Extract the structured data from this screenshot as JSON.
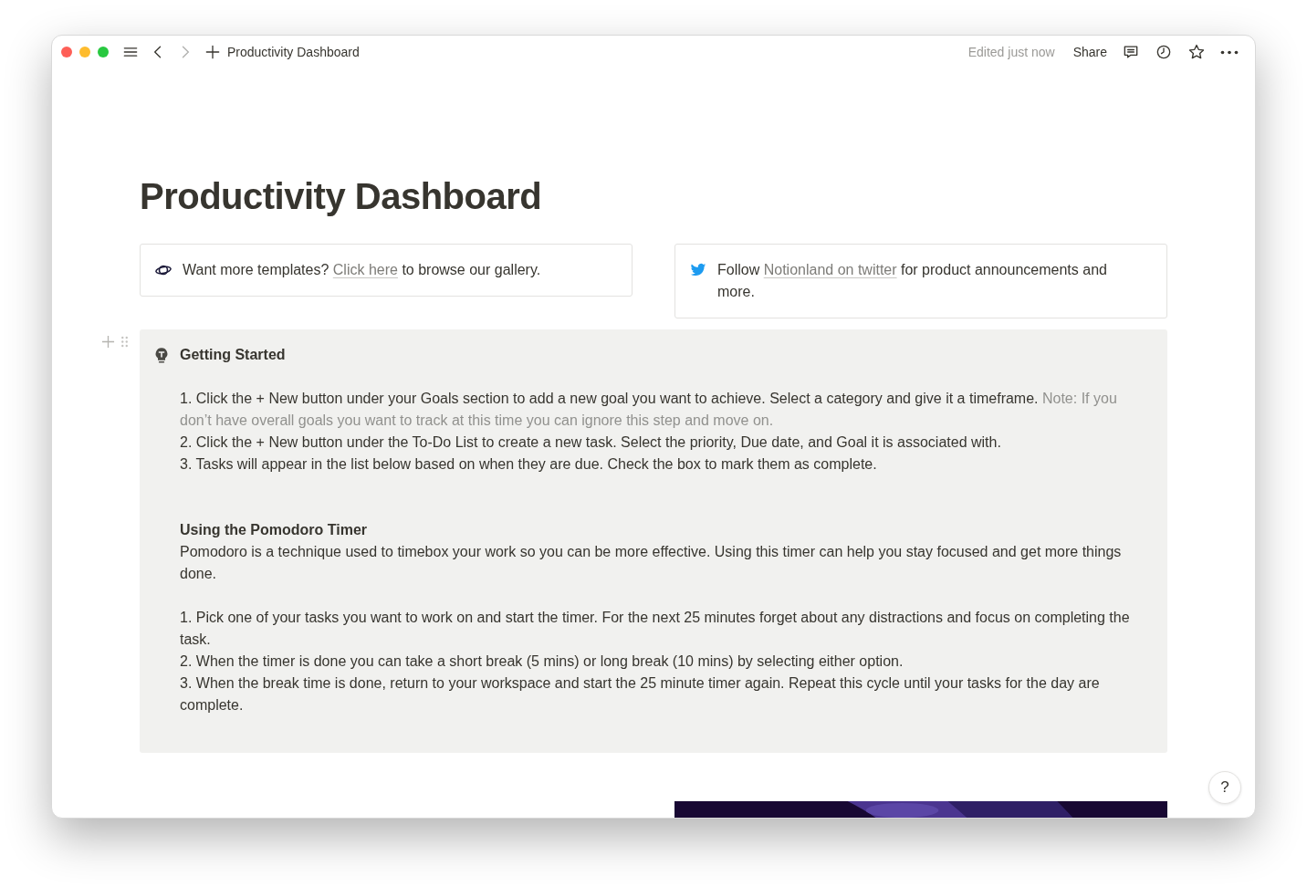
{
  "window": {
    "title": "Productivity Dashboard",
    "edited": "Edited just now",
    "share": "Share"
  },
  "page": {
    "title": "Productivity Dashboard"
  },
  "callouts": [
    {
      "kind": "gallery",
      "segments": [
        {
          "text": "Want more templates? ",
          "kind": "plain"
        },
        {
          "text": "Click here",
          "kind": "link"
        },
        {
          "text": " to browse our gallery.",
          "kind": "plain"
        }
      ]
    },
    {
      "kind": "bird",
      "segments": [
        {
          "text": "Follow ",
          "kind": "plain"
        },
        {
          "text": "Notionland on twitter",
          "kind": "link"
        },
        {
          "text": " for product announcements and more.",
          "kind": "plain"
        }
      ]
    }
  ],
  "guide": {
    "title": "Getting Started",
    "blocks": [
      {
        "kind": "paragraph",
        "segments": [
          {
            "text": "1. Click the + New button under your Goals section to add a new goal you want to achieve. Select a category and give it a timeframe. ",
            "muted": false
          },
          {
            "text": "Note: If you don’t have overall goals you want to track at this time you can ignore this step and move on.",
            "muted": true
          }
        ]
      },
      {
        "kind": "paragraph",
        "segments": [
          {
            "text": "2. Click the + New button under the To-Do List to create a new task. Select the priority, Due date, and Goal it is associated with.",
            "muted": false
          }
        ]
      },
      {
        "kind": "paragraph",
        "segments": [
          {
            "text": "3. Tasks will appear in the list below based on when they are due. Check the box to mark them as complete.",
            "muted": false
          }
        ]
      },
      {
        "kind": "spacer"
      },
      {
        "kind": "spacer"
      },
      {
        "kind": "subheading",
        "segments": [
          {
            "text": "Using the Pomodoro Timer",
            "muted": false
          }
        ]
      },
      {
        "kind": "paragraph",
        "segments": [
          {
            "text": "Pomodoro is a technique used to timebox your work so you can be more effective. Using this timer can help you stay focused and get more things done.",
            "muted": false
          }
        ]
      },
      {
        "kind": "spacer"
      },
      {
        "kind": "paragraph",
        "segments": [
          {
            "text": "1. Pick one of your tasks you want to work on and start the timer. For the next 25 minutes forget about any distractions and focus on completing the task.",
            "muted": false
          }
        ]
      },
      {
        "kind": "paragraph",
        "segments": [
          {
            "text": "2. When the timer is done you can take a short break (5 mins) or long break (10 mins) by selecting either option.",
            "muted": false
          }
        ]
      },
      {
        "kind": "paragraph",
        "segments": [
          {
            "text": "3. When the break time is done, return to your workspace and start the 25 minute timer again. Repeat this cycle until your tasks for the day are complete.",
            "muted": false
          }
        ]
      }
    ]
  },
  "help": "?"
}
